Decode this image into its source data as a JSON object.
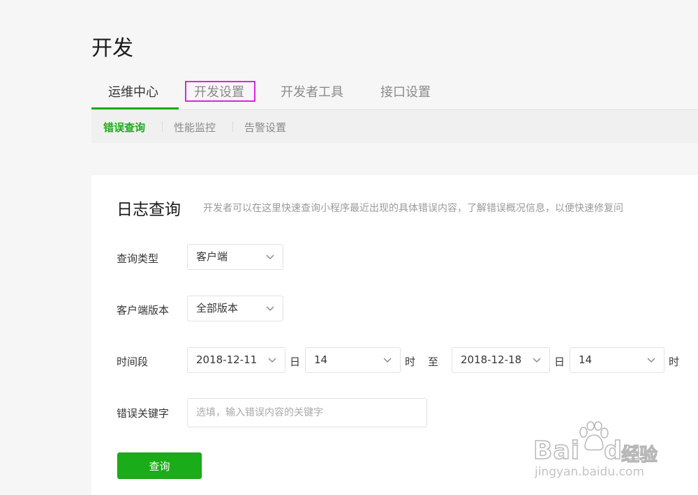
{
  "page": {
    "title": "开发"
  },
  "tabs": [
    {
      "label": "运维中心",
      "active": true
    },
    {
      "label": "开发设置",
      "active": false,
      "highlighted": true
    },
    {
      "label": "开发者工具",
      "active": false
    },
    {
      "label": "接口设置",
      "active": false
    }
  ],
  "subnav": [
    {
      "label": "错误查询",
      "active": true
    },
    {
      "label": "性能监控",
      "active": false
    },
    {
      "label": "告警设置",
      "active": false
    }
  ],
  "card": {
    "title": "日志查询",
    "description": "开发者可以在这里快速查询小程序最近出现的具体错误内容，了解错误概况信息，以便快速修复问"
  },
  "form": {
    "query_type": {
      "label": "查询类型",
      "value": "客户端"
    },
    "client_version": {
      "label": "客户端版本",
      "value": "全部版本"
    },
    "time_range": {
      "label": "时间段",
      "start_date": "2018-12-11",
      "day_unit": "日",
      "start_hour": "14",
      "hour_unit": "时",
      "to": "至",
      "end_date": "2018-12-18",
      "end_hour": "14"
    },
    "keyword": {
      "label": "错误关键字",
      "placeholder": "选填，输入错误内容的关键字",
      "value": ""
    },
    "submit_label": "查询"
  },
  "watermark": {
    "brand": "Bai",
    "brand2": "du",
    "cn": "经验",
    "url": "jingyan.baidu.com"
  },
  "colors": {
    "accent": "#1aad19",
    "highlight": "#e121e1",
    "background": "#f6f6f6"
  }
}
